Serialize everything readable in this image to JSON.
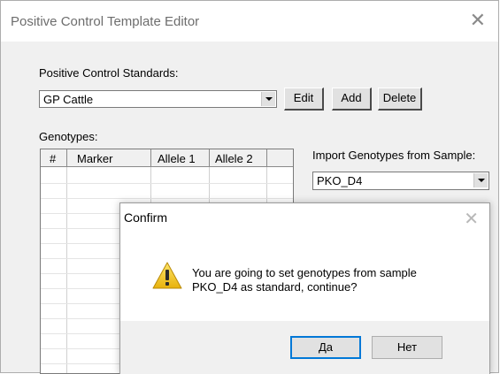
{
  "window": {
    "title": "Positive Control Template Editor"
  },
  "standards": {
    "label": "Positive Control Standards:",
    "selected": "GP Cattle",
    "edit_label": "Edit",
    "add_label": "Add",
    "delete_label": "Delete"
  },
  "genotypes": {
    "label": "Genotypes:",
    "columns": [
      "#",
      "Marker",
      "Allele 1",
      "Allele 2"
    ]
  },
  "import": {
    "label": "Import Genotypes from Sample:",
    "selected": "PKO_D4"
  },
  "dialog": {
    "title": "Confirm",
    "message_line1": "You are going to set genotypes from sample",
    "message_line2": "PKO_D4 as standard, continue?",
    "yes_label": "Да",
    "no_label": "Нет",
    "icon": "warning-icon"
  }
}
